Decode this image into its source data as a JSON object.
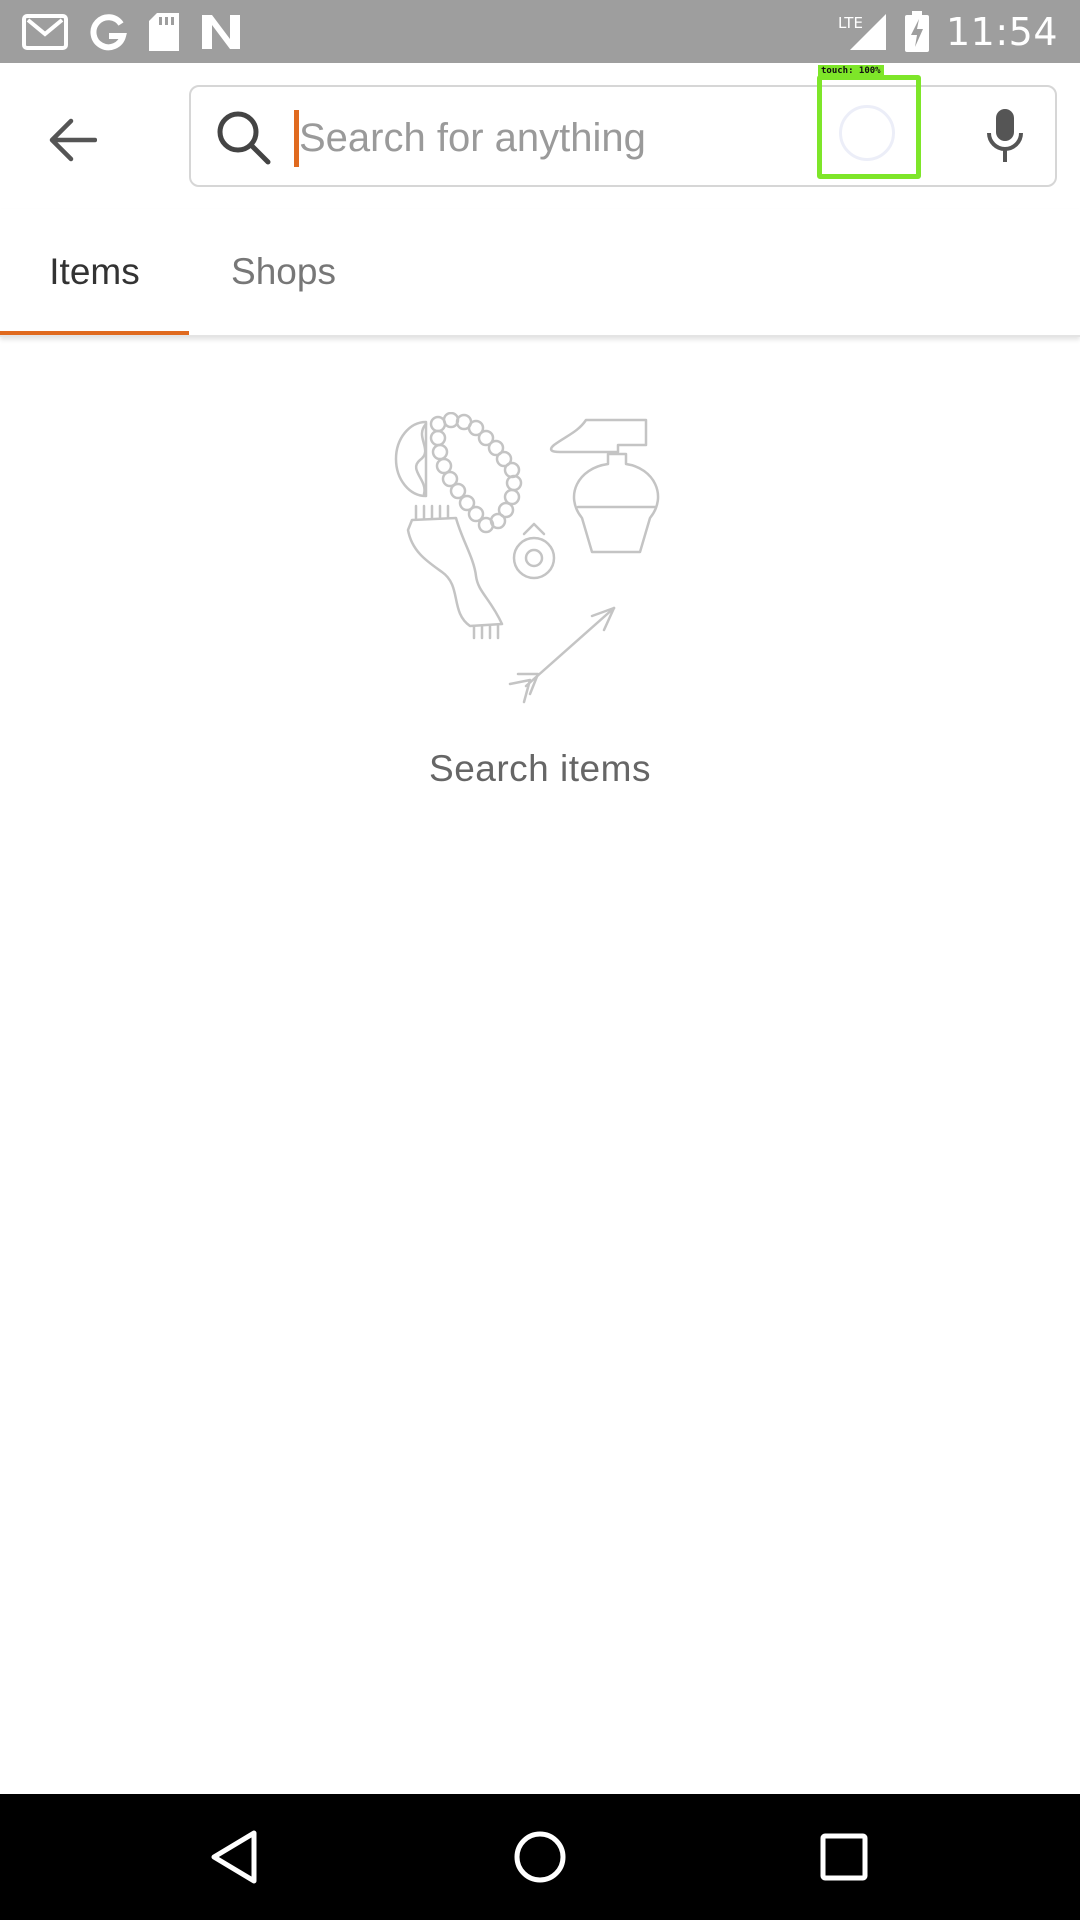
{
  "status_bar": {
    "time": "11:54",
    "network": "LTE",
    "left_icons": [
      "gmail-icon",
      "google-icon",
      "sd-card-icon",
      "n-app-icon"
    ],
    "right_icons": [
      "lte-signal-icon",
      "battery-charging-icon"
    ]
  },
  "toolbar": {
    "back_icon": "arrow-back-icon",
    "search": {
      "placeholder": "Search for anything",
      "value": ""
    },
    "mic_icon": "microphone-icon",
    "touch_overlay_label": "touch: 100%"
  },
  "tabs": [
    {
      "label": "Items",
      "selected": true
    },
    {
      "label": "Shops",
      "selected": false
    }
  ],
  "empty_state": {
    "label": "Search items",
    "illustration": "etsy-items-heart-illustration"
  },
  "nav_bar": {
    "icons": [
      "nav-back-icon",
      "nav-home-icon",
      "nav-recents-icon"
    ]
  },
  "colors": {
    "accent": "#e06a1f",
    "status_bar": "#9e9e9e",
    "touch_overlay": "#7ee629",
    "nav_bar": "#000000"
  }
}
